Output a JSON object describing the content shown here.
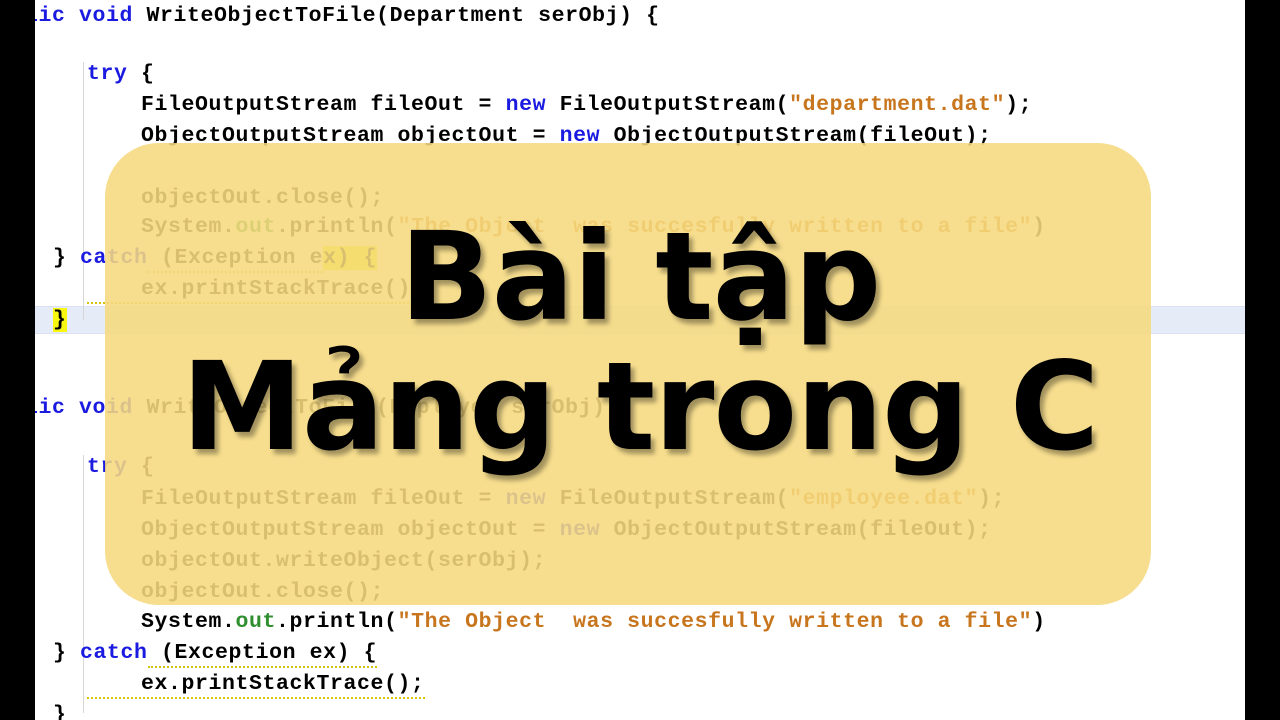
{
  "overlay": {
    "title_line_1": "Bài tập",
    "title_line_2": "Mảng trong C",
    "card_color": "#f6d97e",
    "text_color": "#000000"
  },
  "editor": {
    "background": "#ffffff",
    "current_line_highlight_color": "#e6ecf7",
    "brace_match_highlight_color": "#f7f70f",
    "keyword_color": "#1a1ae0",
    "string_color": "#c8761e",
    "field_color": "#2f8f2f",
    "letterbox_color": "#000000"
  },
  "code": {
    "method_1": {
      "signature_visible": "ublic void WriteObjectToFile(Department serObj) {",
      "signature_kw_1": "ublic",
      "signature_kw_2": "void",
      "signature_rest": " WriteObjectToFile(Department serObj) {",
      "try_keyword": "try",
      "try_rest": " {",
      "line_fileout_a": "    FileOutputStream fileOut = ",
      "line_fileout_kw": "new",
      "line_fileout_b": " FileOutputStream(",
      "line_fileout_str": "\"department.dat\"",
      "line_fileout_c": ");",
      "line_objout_a": "    ObjectOutputStream objectOut = ",
      "line_objout_kw": "new",
      "line_objout_b": " ObjectOutputStream(fileOut);",
      "line_close": "    objectOut.close();",
      "line_println_a": "    System.",
      "line_println_field": "out",
      "line_println_b": ".println(",
      "line_println_str": "\"The Object  was succesfully written to a file\"",
      "line_println_c": ")",
      "line_catch_brace": "}",
      "line_catch_kw": "catch",
      "line_catch_rest": " (Exception e",
      "line_catch_tail": "x) {",
      "line_printstack": "    ex.printStackTrace();",
      "line_close_brace": "}"
    },
    "method_2": {
      "signature_kw_1": "ublic",
      "signature_kw_2": "void",
      "signature_rest": " WriteObjectToFile(Employee serObj) {",
      "try_keyword": "try",
      "try_rest": " {",
      "line_fileout_a": "    FileOutputStream fileOut = ",
      "line_fileout_kw": "new",
      "line_fileout_b": " FileOutputStream(",
      "line_fileout_str": "\"employee.dat\"",
      "line_fileout_c": ");",
      "line_objout_a": "    ObjectOutputStream objectOut = ",
      "line_objout_kw": "new",
      "line_objout_b": " ObjectOutputStream(fileOut);",
      "line_writeobject": "    objectOut.writeObject(serObj);",
      "line_close": "    objectOut.close();",
      "line_println_a": "    System.",
      "line_println_field": "out",
      "line_println_b": ".println(",
      "line_println_str": "\"The Object  was succesfully written to a file\"",
      "line_println_c": ")",
      "line_catch_brace": "}",
      "line_catch_kw": "catch",
      "line_catch_rest": " (Exception ex) {",
      "line_printstack": "    ex.printStackTrace();",
      "line_close_brace": "}"
    }
  }
}
